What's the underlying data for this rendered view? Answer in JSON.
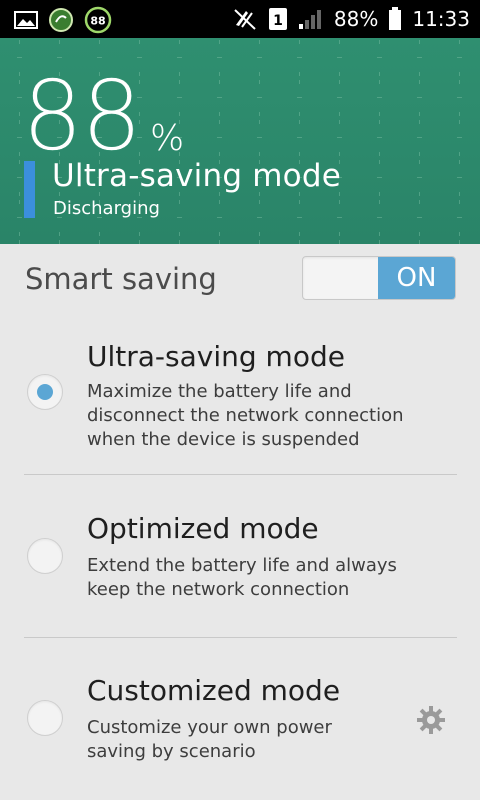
{
  "status_bar": {
    "battery_text": "88%",
    "time": "11:33",
    "sim_slot": "1",
    "badge_number": "88",
    "icons": [
      "image-icon",
      "cleaner-icon",
      "battery-badge-icon",
      "no-notification-icon",
      "sim-icon",
      "signal-icon",
      "battery-icon"
    ]
  },
  "header": {
    "percent_number": "88",
    "percent_sign": "%",
    "mode_title": "Ultra-saving mode",
    "mode_status": "Discharging",
    "accent_color": "#3b8fdc",
    "background_color": "#2f8f70"
  },
  "smart_saving": {
    "label": "Smart saving",
    "toggle_label": "ON",
    "toggle_state": true
  },
  "options": [
    {
      "title": "Ultra-saving mode",
      "description_lines": [
        "Maximize the battery life and",
        "disconnect the network connection",
        "when the device is suspended"
      ],
      "selected": true
    },
    {
      "title": "Optimized mode",
      "description_lines": [
        "Extend the battery life and always",
        "keep the network connection"
      ],
      "selected": false
    },
    {
      "title": "Customized mode",
      "description_lines": [
        "Customize your own power",
        "saving by scenario"
      ],
      "selected": false,
      "icon": "gear-icon"
    }
  ],
  "colors": {
    "radio_selected": "#5ba6d4",
    "toggle_on": "#5ba6d4"
  }
}
